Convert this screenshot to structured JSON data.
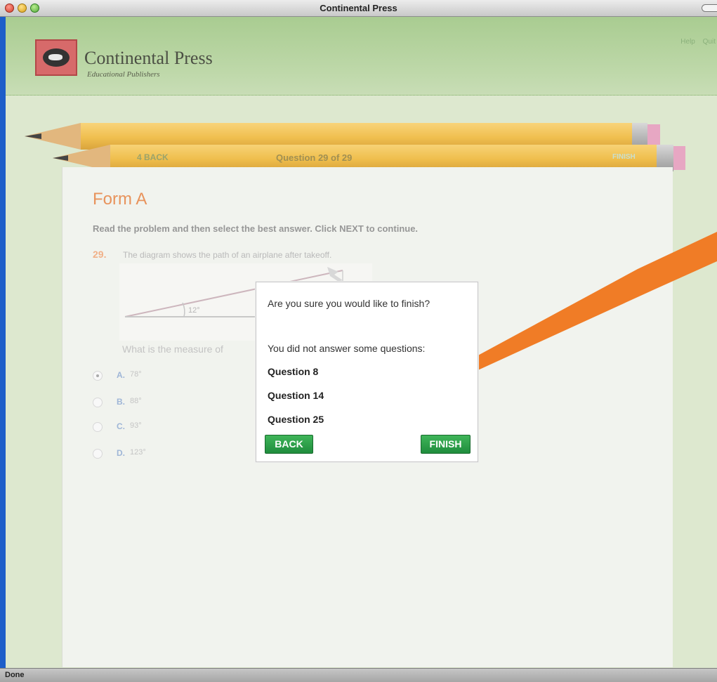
{
  "window": {
    "title": "Continental Press"
  },
  "header": {
    "company_name": "Continental Press",
    "tagline": "Educational Publishers",
    "links": [
      "Help",
      "Quit"
    ]
  },
  "navigation": {
    "back_label": "4 BACK",
    "question_counter": "Question 29 of 29",
    "finish_label": "FINISH"
  },
  "page": {
    "title": "Form A",
    "instructions": "Read the problem and then select the best answer. Click NEXT to continue.",
    "question_number": "29.",
    "question_text": "The diagram shows the path of an airplane after takeoff.",
    "prompt": "What is the measure of",
    "diagram_angle_label": "12°"
  },
  "choices": [
    {
      "letter": "A.",
      "answer": "78°",
      "selected": true
    },
    {
      "letter": "B.",
      "answer": "88°",
      "selected": false
    },
    {
      "letter": "C.",
      "answer": "93°",
      "selected": false
    },
    {
      "letter": "D.",
      "answer": "123°",
      "selected": false
    }
  ],
  "dialog": {
    "confirm_text": "Are you sure you would like to finish?",
    "warning_text": "You did not answer some questions:",
    "unanswered": [
      "Question 8",
      "Question 14",
      "Question 25"
    ],
    "back_button": "BACK",
    "finish_button": "FINISH"
  },
  "status_bar": {
    "text": "Done"
  },
  "colors": {
    "accent_orange": "#f07c26",
    "button_green": "#2a9b48",
    "form_title": "#e8935c"
  }
}
